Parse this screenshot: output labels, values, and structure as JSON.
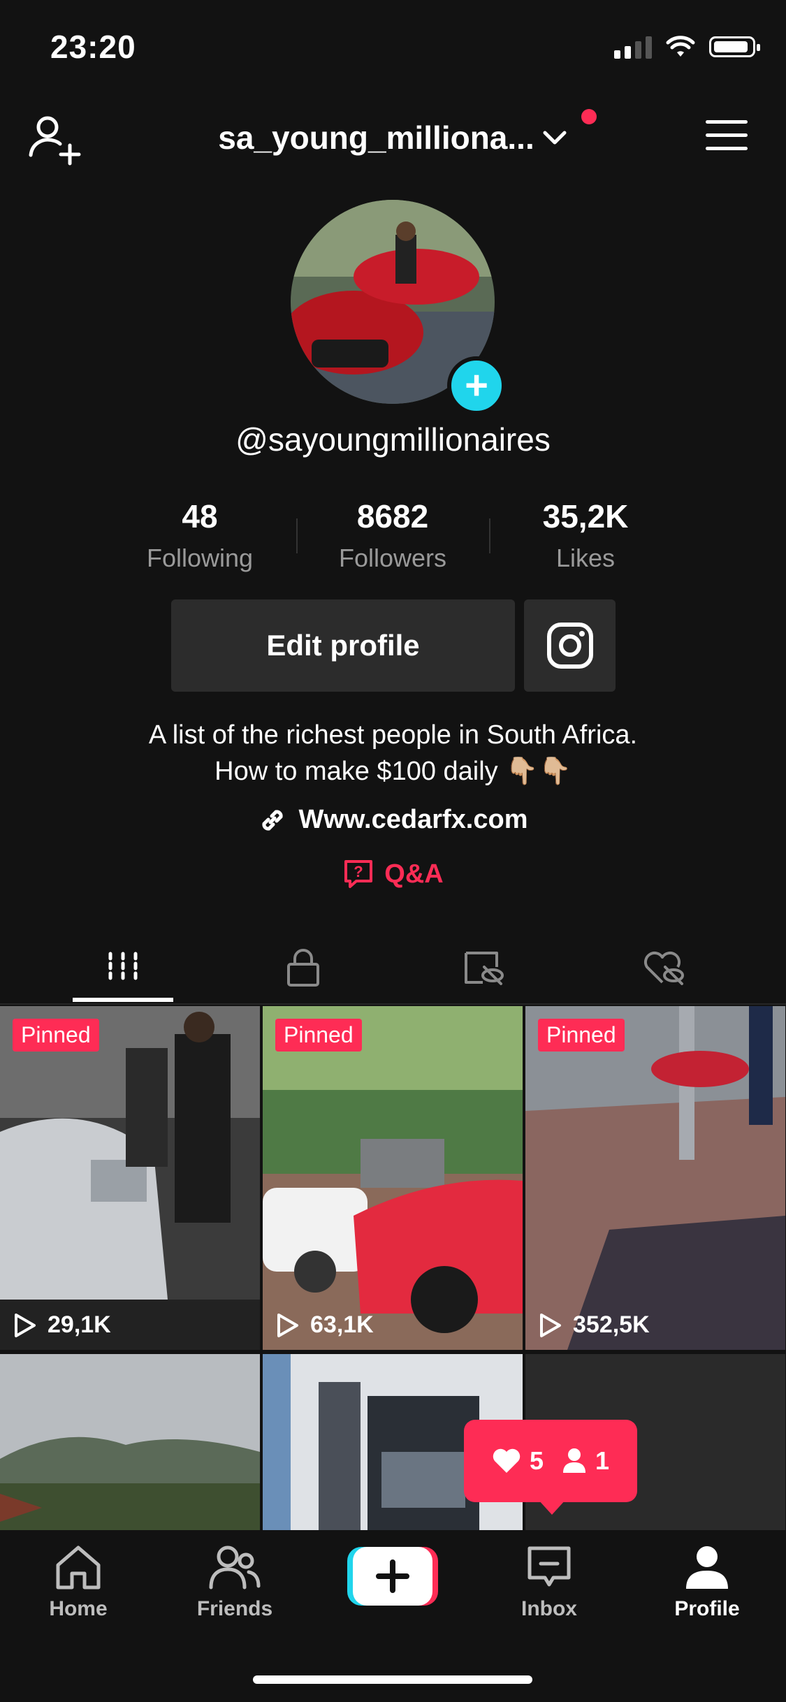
{
  "status_bar": {
    "time": "23:20"
  },
  "header": {
    "username": "sa_young_milliona..."
  },
  "profile": {
    "handle": "@sayoungmillionaires",
    "stats": [
      {
        "value": "48",
        "label": "Following"
      },
      {
        "value": "8682",
        "label": "Followers"
      },
      {
        "value": "35,2K",
        "label": "Likes"
      }
    ],
    "edit_label": "Edit profile",
    "bio_line1": "A list of the richest people in South Africa.",
    "bio_line2": "How to make $100 daily 👇🏼👇🏼",
    "link": "Www.cedarfx.com",
    "qa_label": "Q&A"
  },
  "tabs": [
    "videos-grid-icon",
    "lock-icon",
    "eye-hidden-icon",
    "heart-hidden-icon"
  ],
  "videos": [
    {
      "badge": "Pinned",
      "views": "29,1K"
    },
    {
      "badge": "Pinned",
      "views": "63,1K"
    },
    {
      "badge": "Pinned",
      "views": "352,5K"
    }
  ],
  "popup": {
    "likes": "5",
    "followers": "1"
  },
  "nav": {
    "home": "Home",
    "friends": "Friends",
    "inbox": "Inbox",
    "profile": "Profile"
  },
  "colors": {
    "accent": "#fe2c55",
    "teal": "#20d5ec",
    "background": "#121212"
  }
}
